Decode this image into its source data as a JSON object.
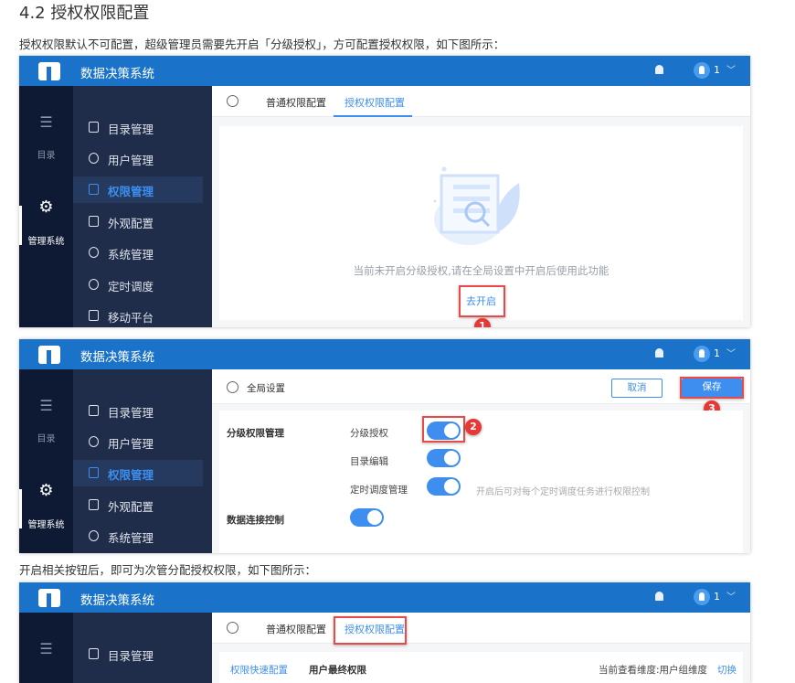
{
  "heading": "4.2 授权权限配置",
  "intro": "授权权限默认不可配置，超级管理员需要先开启「分级授权」，方可配置授权权限，如下图所示：",
  "after": "开启相关按钮后，即可为次管分配授权权限，如下图所示：",
  "app": {
    "title": "数据决策系统",
    "user": "1",
    "rail": [
      "目录",
      "管理系统"
    ],
    "menu": [
      "目录管理",
      "用户管理",
      "权限管理",
      "外观配置",
      "系统管理",
      "定时调度",
      "移动平台"
    ],
    "tabs": [
      "普通权限配置",
      "授权权限配置"
    ]
  },
  "shot1": {
    "empty_text": "当前未开启分级授权,请在全局设置中开启后使用此功能",
    "enable_link": "去开启",
    "step": "1"
  },
  "shot2": {
    "toolbar_title": "全局设置",
    "cancel": "取消",
    "save": "保存",
    "step_toggle": "2",
    "step_save": "3",
    "section1": "分级权限管理",
    "rows": [
      {
        "label": "分级授权",
        "on": true
      },
      {
        "label": "目录编辑",
        "on": true
      },
      {
        "label": "定时调度管理",
        "on": true,
        "hint": "开启后可对每个定时调度任务进行权限控制"
      }
    ],
    "section2": "数据连接控制",
    "section2_on": true
  },
  "shot3": {
    "subtabs": [
      "权限快速配置",
      "用户最终权限"
    ],
    "dimension": "当前查看维度:用户组维度",
    "switch": "切换"
  },
  "colors": {
    "header": "#1a73c8",
    "accent": "#3d8eef",
    "highlight": "#e84a4a"
  }
}
